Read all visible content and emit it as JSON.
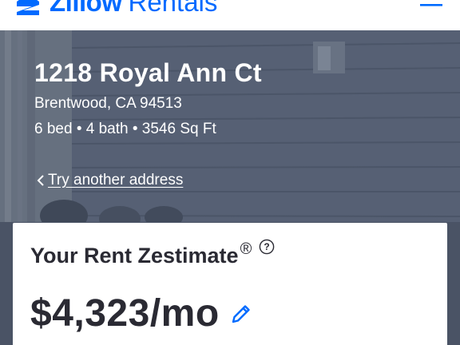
{
  "header": {
    "logo_text": "Zillow",
    "logo_suffix": "Rentals",
    "menu_icon": "hamburger-menu-icon",
    "brand_color": "#006aff"
  },
  "hero": {
    "address": "1218 Royal Ann Ct",
    "city_line": "Brentwood, CA 94513",
    "details_line": "6 bed • 4 bath • 3546 Sq Ft",
    "try_another_label": "Try another address",
    "back_icon": "chevron-left-icon"
  },
  "estimate": {
    "title": "Your Rent Zestimate",
    "registered_mark": "®",
    "help_icon": "question-circle-icon",
    "help_symbol": "?",
    "price": "$4,323/mo",
    "edit_icon": "pencil-icon"
  },
  "colors": {
    "text_dark": "#2a2a33",
    "hero_overlay": "#4f5a6e",
    "accent": "#006aff"
  }
}
